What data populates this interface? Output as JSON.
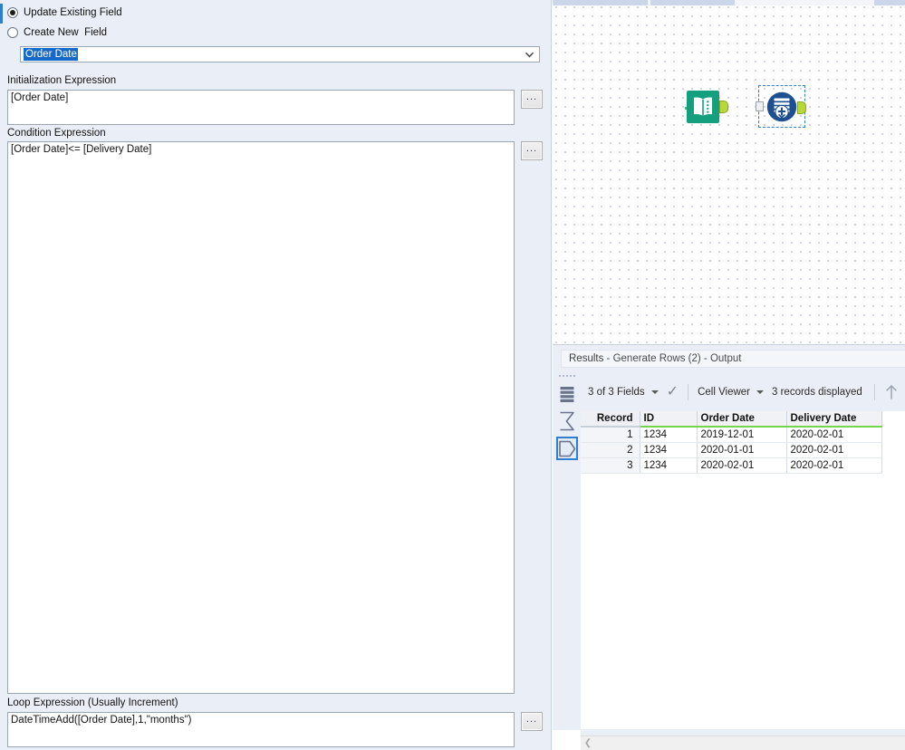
{
  "config": {
    "radios": [
      {
        "label": "Update Existing Field",
        "checked": true,
        "name": "update-existing-field"
      },
      {
        "label": "Create New  Field",
        "checked": false,
        "name": "create-new-field"
      }
    ],
    "field_select": {
      "value": "Order Date",
      "icon": "chevron-down-icon"
    },
    "sections": [
      {
        "label": "Initialization Expression",
        "value": "[Order Date]",
        "button_label": "...",
        "name": "initialization-expression"
      },
      {
        "label": "Condition Expression",
        "value": "[Order Date]<= [Delivery Date]",
        "button_label": "...",
        "name": "condition-expression"
      },
      {
        "label": "Loop Expression (Usually Increment)",
        "value": "DateTimeAdd([Order Date],1,\"months\")",
        "button_label": "...",
        "name": "loop-expression"
      }
    ]
  },
  "canvas": {
    "nodes": [
      {
        "name": "text-input-tool",
        "icon": "book-icon",
        "label": ""
      },
      {
        "name": "generate-rows-tool",
        "icon": "generate-rows-icon",
        "label": "",
        "selected": true
      }
    ],
    "connection": {
      "name": "connection-line"
    }
  },
  "results": {
    "title_prefix": "Results",
    "title_rest": " - Generate Rows (2) - Output",
    "sidebar_icons": [
      {
        "name": "table-view-icon",
        "selected": false
      },
      {
        "name": "summary-sigma-icon",
        "selected": false
      },
      {
        "name": "data-output-icon",
        "selected": true
      }
    ],
    "toolbar": {
      "fields_label": "3 of 3 Fields",
      "fields_caret": "chevron-down-icon",
      "check_icon": "checkmark-icon",
      "viewer_label": "Cell Viewer",
      "viewer_caret": "chevron-down-icon",
      "records_label": "3 records displayed",
      "up_arrow_icon": "arrow-up-icon"
    },
    "table": {
      "columns": [
        "Record",
        "ID",
        "Order Date",
        "Delivery Date"
      ],
      "rows": [
        [
          "1",
          "1234",
          "2019-12-01",
          "2020-02-01"
        ],
        [
          "2",
          "1234",
          "2020-01-01",
          "2020-02-01"
        ],
        [
          "3",
          "1234",
          "2020-02-01",
          "2020-02-01"
        ]
      ]
    },
    "hscroll": {
      "left_arrow_icon": "chevron-left-icon"
    }
  },
  "colors": {
    "accent_blue": "#2f7fd0",
    "panel_blue": "#eaeff7",
    "header_green": "#74d64a",
    "connection_green": "#4fb56b",
    "anchor_green": "#b9d838",
    "tool_teal": "#14a07f",
    "tool_navy": "#1d4f91",
    "selection_blue": "#1669c8"
  }
}
